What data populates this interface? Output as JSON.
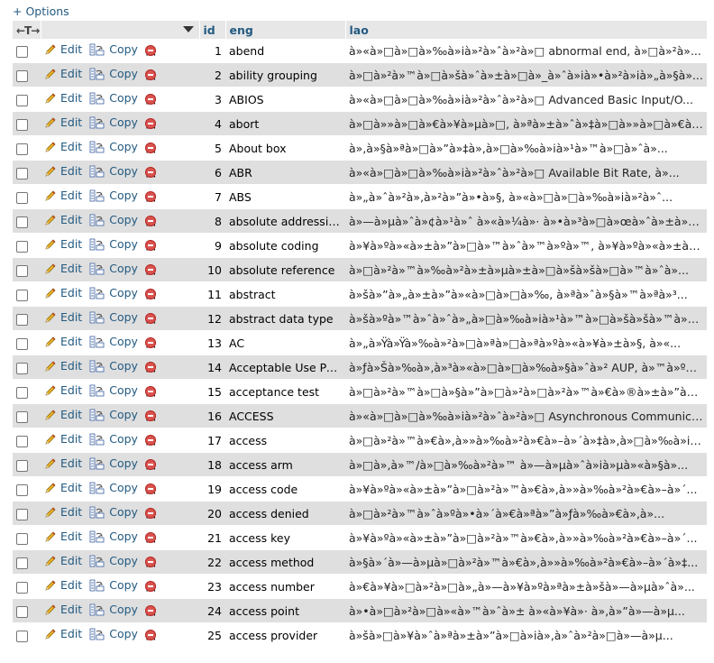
{
  "options_label": "+ Options",
  "header": {
    "nav_arrows": "←T→",
    "col_id": "id",
    "col_eng": "eng",
    "col_lao": "lao"
  },
  "actions": {
    "edit": "Edit",
    "copy": "Copy",
    "delete": "Delete"
  },
  "rows": [
    {
      "id": "1",
      "eng": "abend",
      "lao": "à»«à»□à»□à»‰à»ià»²à»ˆà»²à»□ abnormal end, à»□à»²à»..."
    },
    {
      "id": "2",
      "eng": "ability grouping",
      "lao": "à»□à»²à»™à»□à»šà»ˆà»±à»□à»_à»ˆà»ià»•à»²à»ià»„à»§à»..."
    },
    {
      "id": "3",
      "eng": "ABIOS",
      "lao": "à»«à»□à»□à»‰à»ià»²à»ˆà»²à»□ Advanced Basic Input/O..."
    },
    {
      "id": "4",
      "eng": "abort",
      "lao": "à»□à»»à»□à»€à»¥à»µà»□, à»ªà»±à»ˆà»‡à»□à»»à»□à»€à»¥..."
    },
    {
      "id": "5",
      "eng": "About box",
      "lao": "à»‚à»§à»ªà»□à»”à»‡à»‚à»□à»‰à»ià»¹à»™à»□à»ˆà»..."
    },
    {
      "id": "6",
      "eng": "ABR",
      "lao": "à»«à»□à»□à»‰à»ià»²à»ˆà»²à»□ Available Bit Rate, à»..."
    },
    {
      "id": "7",
      "eng": "ABS",
      "lao": "à»„à»ˆà»²à»‚à»²à»”à»•à»§, à»«à»□à»□à»‰à»ià»²à»ˆ..."
    },
    {
      "id": "8",
      "eng": "absolute addressing",
      "lao": "à»—à»µà»ˆà»¢à»¹à»ˆ à»«à»¼à»· à»•à»³à»□à»œà»ˆà»±à»□..."
    },
    {
      "id": "9",
      "eng": "absolute coding",
      "lao": "à»¥à»ºà»«à»±à»”à»□à»™à»ˆà»™à»ºà»™, à»¥à»ºà»«à»±à»”..."
    },
    {
      "id": "10",
      "eng": "absolute reference",
      "lao": "à»□à»²à»™à»‰à»²à»±à»µà»±à»□à»šà»šà»□à»™à»ˆà»..."
    },
    {
      "id": "11",
      "eng": "abstract",
      "lao": "à»šà»”à»„à»±à»”à»«à»□à»□à»‰, à»ªà»ˆà»§à»™à»ªà»³..."
    },
    {
      "id": "12",
      "eng": "abstract data type",
      "lao": "à»šà»ºà»™à»ˆà»ˆà»„à»□à»‰à»ià»¹à»™à»□à»šà»šà»™à»²à»..."
    },
    {
      "id": "13",
      "eng": "AC",
      "lao": "à»„à»Ÿà»Ÿà»‰à»²à»□à»ªà»□à»ªà»ºà»«à»¥à»±à»§, à»«..."
    },
    {
      "id": "14",
      "eng": "Acceptable Use Policy",
      "lao": "à»ƒà»Šà»‰à»‚à»³à»«à»□à»□à»‰à»§à»ˆà»² AUP, à»™à»ºà»..."
    },
    {
      "id": "15",
      "eng": "acceptance test",
      "lao": "à»□à»²à»™à»□à»§à»”à»□à»²à»□à»²à»™à»€à»®à»±à»”à»§à»..."
    },
    {
      "id": "16",
      "eng": "ACCESS",
      "lao": "à»«à»□à»□à»‰à»ià»²à»ˆà»²à»□ Asynchronous Communica..."
    },
    {
      "id": "17",
      "eng": "access",
      "lao": "à»□à»²à»™à»€à»‚à»»à»‰à»²à»€à»–à»´à»‡à»‚à»□à»‰à»ià»..."
    },
    {
      "id": "18",
      "eng": "access arm",
      "lao": "à»□à»‚à»™/à»□à»‰à»²à»™ à»—à»µà»ˆà»ià»µà»«à»§à»..."
    },
    {
      "id": "19",
      "eng": "access code",
      "lao": "à»¥à»ºà»«à»±à»”à»□à»²à»™à»€à»‚à»»à»‰à»²à»€à»–à»´..."
    },
    {
      "id": "20",
      "eng": "access denied",
      "lao": "à»□à»²à»™à»ˆà»ºà»•à»´à»€à»ªà»”à»ƒà»‰à»€à»‚à»..."
    },
    {
      "id": "21",
      "eng": "access key",
      "lao": "à»¥à»ºà»«à»±à»”à»□à»²à»™à»€à»‚à»»à»‰à»²à»€à»–à»´..."
    },
    {
      "id": "22",
      "eng": "access method",
      "lao": "à»§à»´à»—à»µà»□à»²à»™à»€à»‚à»»à»‰à»²à»€à»–à»´à»‡..."
    },
    {
      "id": "23",
      "eng": "access number",
      "lao": "à»€à»¥à»□à»²à»□à»„à»—à»¥à»ºà»ªà»±à»šà»—à»µà»ˆà»..."
    },
    {
      "id": "24",
      "eng": "access point",
      "lao": "à»•à»□à»²à»□à»«à»™à»ˆà»± à»«à»¥à»· à»‚à»”à»—à»µ..."
    },
    {
      "id": "25",
      "eng": "access provider",
      "lao": "à»šà»□à»¥à»ˆà»ªà»±à»”à»□à»ià»‚à»ˆà»²à»□à»—à»µ..."
    }
  ]
}
